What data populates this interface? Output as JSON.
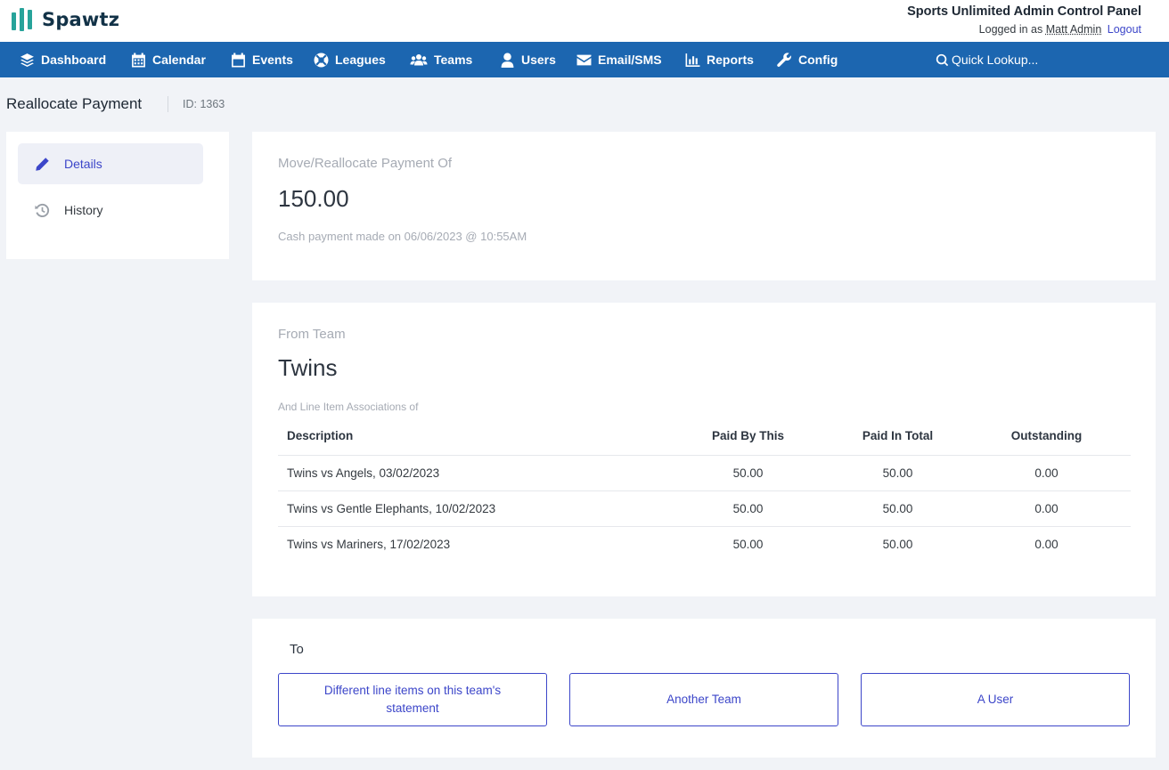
{
  "header": {
    "logo_text": "Spawtz",
    "panel_title": "Sports Unlimited Admin Control Panel",
    "logged_in_prefix": "Logged in as",
    "user_name": "Matt Admin",
    "logout_label": "Logout"
  },
  "nav": {
    "items": [
      {
        "label": "Dashboard",
        "icon": "layers-icon"
      },
      {
        "label": "Calendar",
        "icon": "calendar-grid-icon"
      },
      {
        "label": "Events",
        "icon": "calendar-icon"
      },
      {
        "label": "Leagues",
        "icon": "life-ring-icon"
      },
      {
        "label": "Teams",
        "icon": "users-group-icon"
      },
      {
        "label": "Users",
        "icon": "user-icon"
      },
      {
        "label": "Email/SMS",
        "icon": "envelope-icon"
      },
      {
        "label": "Reports",
        "icon": "bar-chart-icon"
      },
      {
        "label": "Config",
        "icon": "wrench-icon"
      }
    ],
    "quick_lookup": "Quick Lookup..."
  },
  "page": {
    "title": "Reallocate Payment",
    "id_label": "ID: 1363"
  },
  "sidebar": {
    "items": [
      {
        "label": "Details",
        "icon": "pencil-icon",
        "active": true
      },
      {
        "label": "History",
        "icon": "history-icon",
        "active": false
      }
    ]
  },
  "payment": {
    "label": "Move/Reallocate Payment Of",
    "amount": "150.00",
    "description": "Cash payment made on 06/06/2023 @ 10:55AM"
  },
  "from_team": {
    "label": "From Team",
    "team_name": "Twins",
    "assoc_label": "And Line Item Associations of",
    "columns": [
      "Description",
      "Paid By This",
      "Paid In Total",
      "Outstanding"
    ],
    "rows": [
      {
        "description": "Twins vs Angels, 03/02/2023",
        "paid_by_this": "50.00",
        "paid_in_total": "50.00",
        "outstanding": "0.00"
      },
      {
        "description": "Twins vs Gentle Elephants, 10/02/2023",
        "paid_by_this": "50.00",
        "paid_in_total": "50.00",
        "outstanding": "0.00"
      },
      {
        "description": "Twins vs Mariners, 17/02/2023",
        "paid_by_this": "50.00",
        "paid_in_total": "50.00",
        "outstanding": "0.00"
      }
    ]
  },
  "to": {
    "label": "To",
    "options": [
      "Different line items on this team's statement",
      "Another Team",
      "A User"
    ]
  },
  "colors": {
    "nav_bg": "#1c66b0",
    "accent": "#3c46c9",
    "logo_accent": "#27a39a",
    "page_bg": "#f1f3f7"
  }
}
